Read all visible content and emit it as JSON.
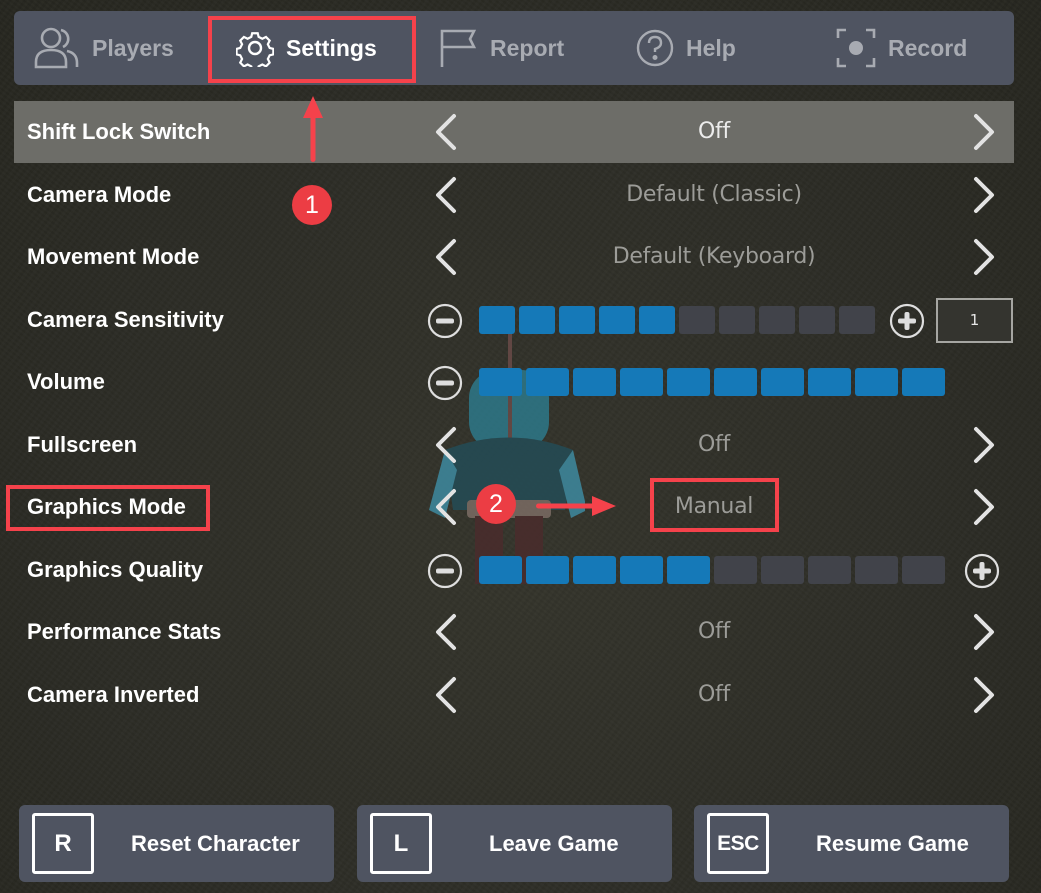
{
  "tabs": [
    {
      "id": "players",
      "label": "Players",
      "icon": "players-icon",
      "active": false
    },
    {
      "id": "settings",
      "label": "Settings",
      "icon": "gear-icon",
      "active": true
    },
    {
      "id": "report",
      "label": "Report",
      "icon": "flag-icon",
      "active": false
    },
    {
      "id": "help",
      "label": "Help",
      "icon": "help-circle-icon",
      "active": false
    },
    {
      "id": "record",
      "label": "Record",
      "icon": "record-icon",
      "active": false
    }
  ],
  "settings": {
    "shift_lock": {
      "label": "Shift Lock Switch",
      "value": "Off",
      "selected": true
    },
    "camera_mode": {
      "label": "Camera Mode",
      "value": "Default (Classic)"
    },
    "movement_mode": {
      "label": "Movement Mode",
      "value": "Default (Keyboard)"
    },
    "camera_sensitivity": {
      "label": "Camera Sensitivity",
      "level": 5,
      "max": 10,
      "input_value": "1"
    },
    "volume": {
      "label": "Volume",
      "level": 10,
      "max": 10
    },
    "fullscreen": {
      "label": "Fullscreen",
      "value": "Off"
    },
    "graphics_mode": {
      "label": "Graphics Mode",
      "value": "Manual"
    },
    "graphics_quality": {
      "label": "Graphics Quality",
      "level": 5,
      "max": 10
    },
    "performance_stats": {
      "label": "Performance Stats",
      "value": "Off"
    },
    "camera_inverted": {
      "label": "Camera Inverted",
      "value": "Off"
    }
  },
  "bottom_buttons": {
    "reset": {
      "key": "R",
      "label": "Reset Character"
    },
    "leave": {
      "key": "L",
      "label": "Leave Game"
    },
    "resume": {
      "key": "ESC",
      "label": "Resume Game"
    }
  },
  "annotations": {
    "step1": "1",
    "step2": "2"
  },
  "colors": {
    "panel": "#4f5461",
    "slider_on": "#1579b8",
    "slider_off": "#41434a",
    "highlight": "#f5424b",
    "badge": "#ec3d44",
    "selected_row": "#6d6d68"
  }
}
